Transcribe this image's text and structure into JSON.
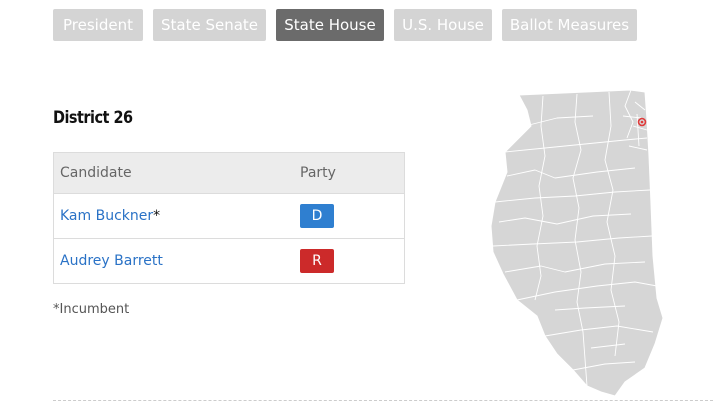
{
  "tabs": [
    {
      "label": "President",
      "active": false
    },
    {
      "label": "State Senate",
      "active": false
    },
    {
      "label": "State House",
      "active": true
    },
    {
      "label": "U.S. House",
      "active": false
    },
    {
      "label": "Ballot Measures",
      "active": false
    }
  ],
  "district": {
    "title": "District 26"
  },
  "table": {
    "headers": {
      "candidate": "Candidate",
      "party": "Party"
    },
    "rows": [
      {
        "name": "Kam Buckner",
        "incumbent_mark": "*",
        "party": "D",
        "party_color": "#2f7fd0"
      },
      {
        "name": "Audrey Barrett",
        "incumbent_mark": "",
        "party": "R",
        "party_color": "#cc2a2a"
      }
    ]
  },
  "footnote": "*Incumbent",
  "map": {
    "fill_color": "#d6d6d6",
    "highlight_color": "#e03a3a"
  },
  "colors": {
    "tab_inactive": "#d4d4d4",
    "tab_active": "#6b6b6b",
    "link": "#2a72c6"
  }
}
